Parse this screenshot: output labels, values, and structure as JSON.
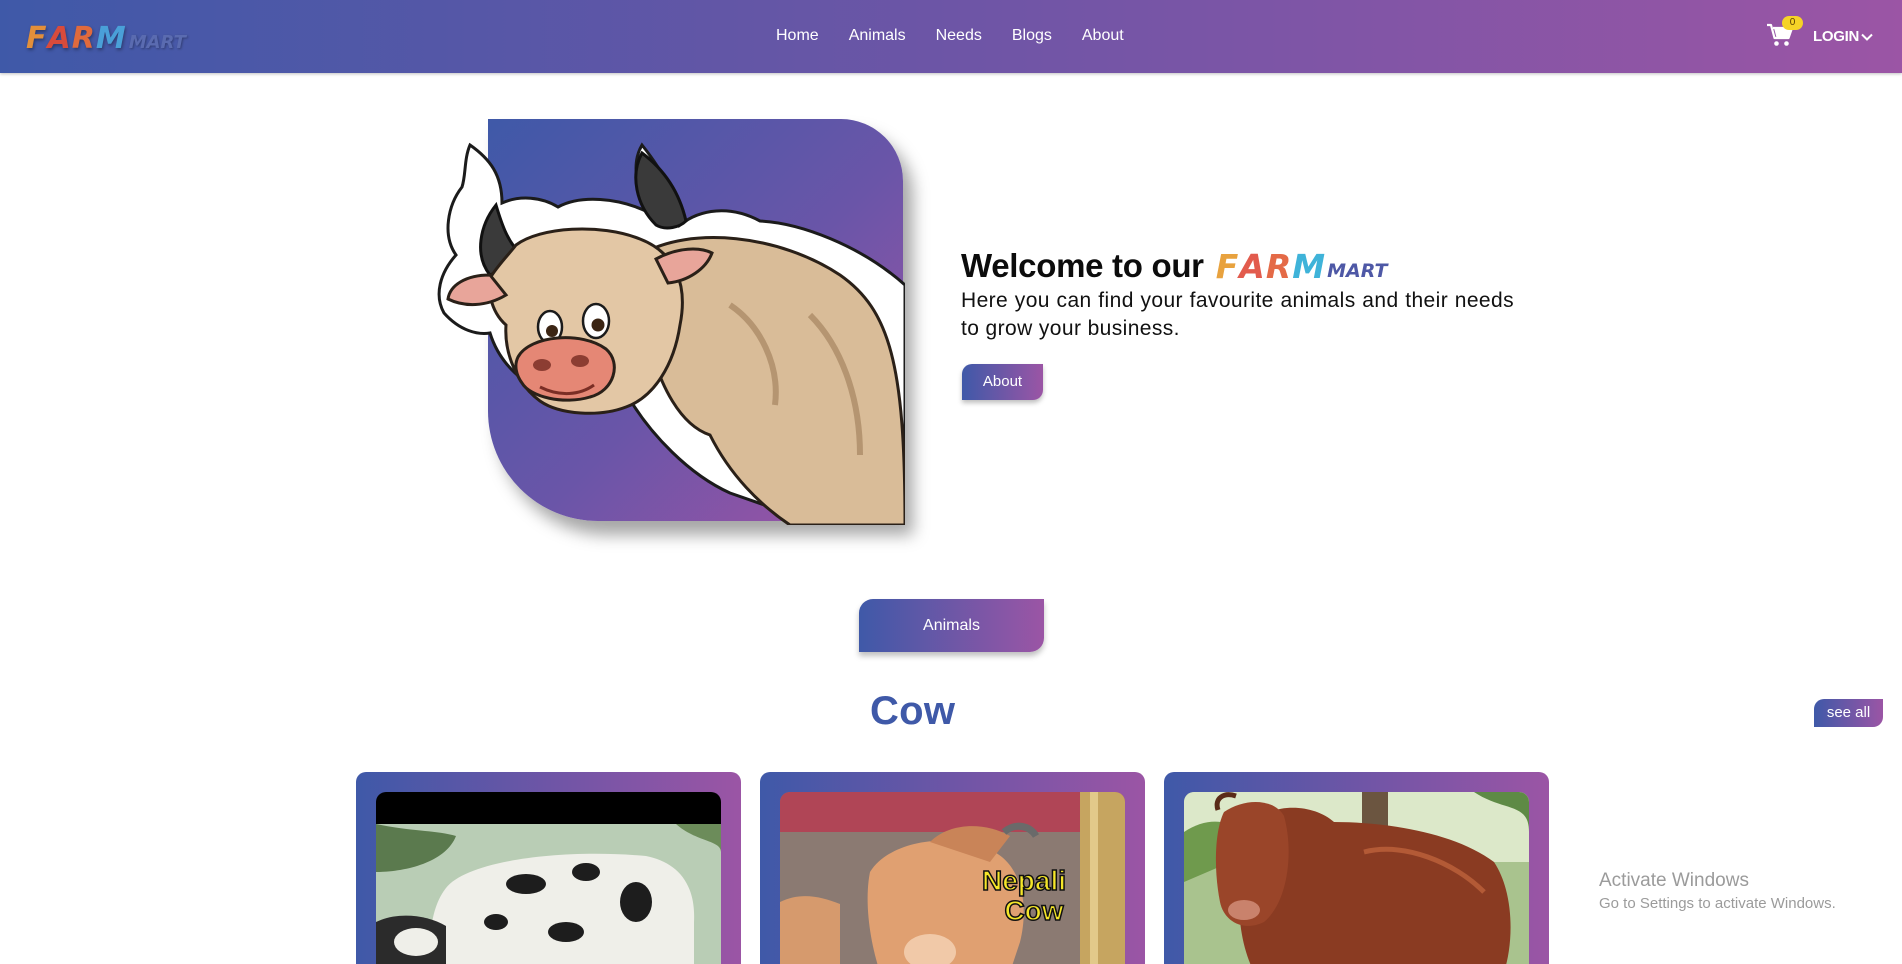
{
  "brand": {
    "logo_letters": [
      "F",
      "A",
      "R",
      "M"
    ],
    "logo_letter_colors": [
      "#e38f3a",
      "#d84b3c",
      "#4aa0d8",
      "#4a7dd2"
    ],
    "logo_suffix": "MART",
    "logo_suffix_color": "#5a5fa8"
  },
  "nav": {
    "links": [
      "Home",
      "Animals",
      "Needs",
      "Blogs",
      "About"
    ]
  },
  "header_right": {
    "cart_icon": "cart-icon",
    "cart_count": "0",
    "login_label": "LOGIN",
    "login_chevron_icon": "chevron-down-icon"
  },
  "hero": {
    "heading": "Welcome to our",
    "heading_logo_letters": [
      "F",
      "A",
      "R",
      "M"
    ],
    "heading_logo_letter_colors": [
      "#e8a23e",
      "#e25b4d",
      "#3fb3d9",
      "#4a7dd2"
    ],
    "heading_logo_suffix": "MART",
    "tagline": "Here you can find your favourite animals and their needs to grow your business.",
    "about_button": "About",
    "illustration": "cartoon-bull-illustration"
  },
  "animals_section": {
    "button_label": "Animals",
    "category_title": "Cow",
    "see_all_label": "see all",
    "cards": [
      {
        "image": "holstein-cow-photo"
      },
      {
        "image": "nepali-cow-photo",
        "overlay_text": "Nepali Cow"
      },
      {
        "image": "brown-cow-photo"
      }
    ]
  },
  "os_overlay": {
    "title": "Activate Windows",
    "subtitle": "Go to Settings to activate Windows."
  },
  "colors": {
    "gradient_start": "#3f59a8",
    "gradient_end": "#9b55a5",
    "badge": "#f5d327",
    "title_blue": "#3f59a8"
  }
}
